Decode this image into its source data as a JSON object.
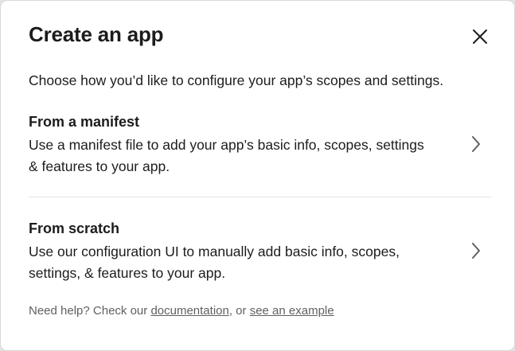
{
  "modal": {
    "title": "Create an app",
    "subtitle": "Choose how you’d like to configure your app’s scopes and settings.",
    "close_icon": "close-icon"
  },
  "options": [
    {
      "title": "From a manifest",
      "description": "Use a manifest file to add your app’s basic info, scopes, settings & features to your app.",
      "icon": "chevron-right-icon"
    },
    {
      "title": "From scratch",
      "description": "Use our configuration UI to manually add basic info, scopes, settings, & features to your app.",
      "icon": "chevron-right-icon"
    }
  ],
  "help": {
    "prefix": "Need help? Check our ",
    "documentation_link": "documentation",
    "middle": ", or ",
    "example_link": "see an example"
  },
  "colors": {
    "text": "#1d1c1d",
    "muted_text": "#616061",
    "divider": "#e2e2e2",
    "background": "#ffffff"
  }
}
